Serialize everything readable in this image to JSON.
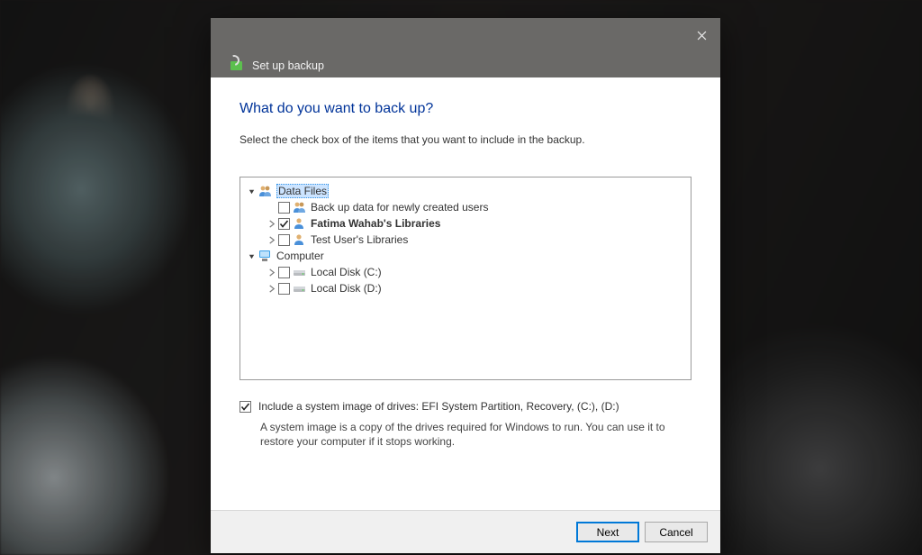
{
  "window": {
    "title": "Set up backup"
  },
  "page": {
    "heading": "What do you want to back up?",
    "subtext": "Select the check box of the items that you want to include in the backup."
  },
  "tree": {
    "data_files": {
      "label": "Data Files",
      "children": {
        "new_users": "Back up data for newly created users",
        "fatima": "Fatima Wahab's Libraries",
        "test": "Test User's Libraries"
      }
    },
    "computer": {
      "label": "Computer",
      "children": {
        "c": "Local Disk (C:)",
        "d": "Local Disk (D:)"
      }
    }
  },
  "systemImage": {
    "label": "Include a system image of drives: EFI System Partition, Recovery, (C:), (D:)",
    "desc": "A system image is a copy of the drives required for Windows to run. You can use it to restore your computer if it stops working."
  },
  "buttons": {
    "next": "Next",
    "cancel": "Cancel"
  }
}
